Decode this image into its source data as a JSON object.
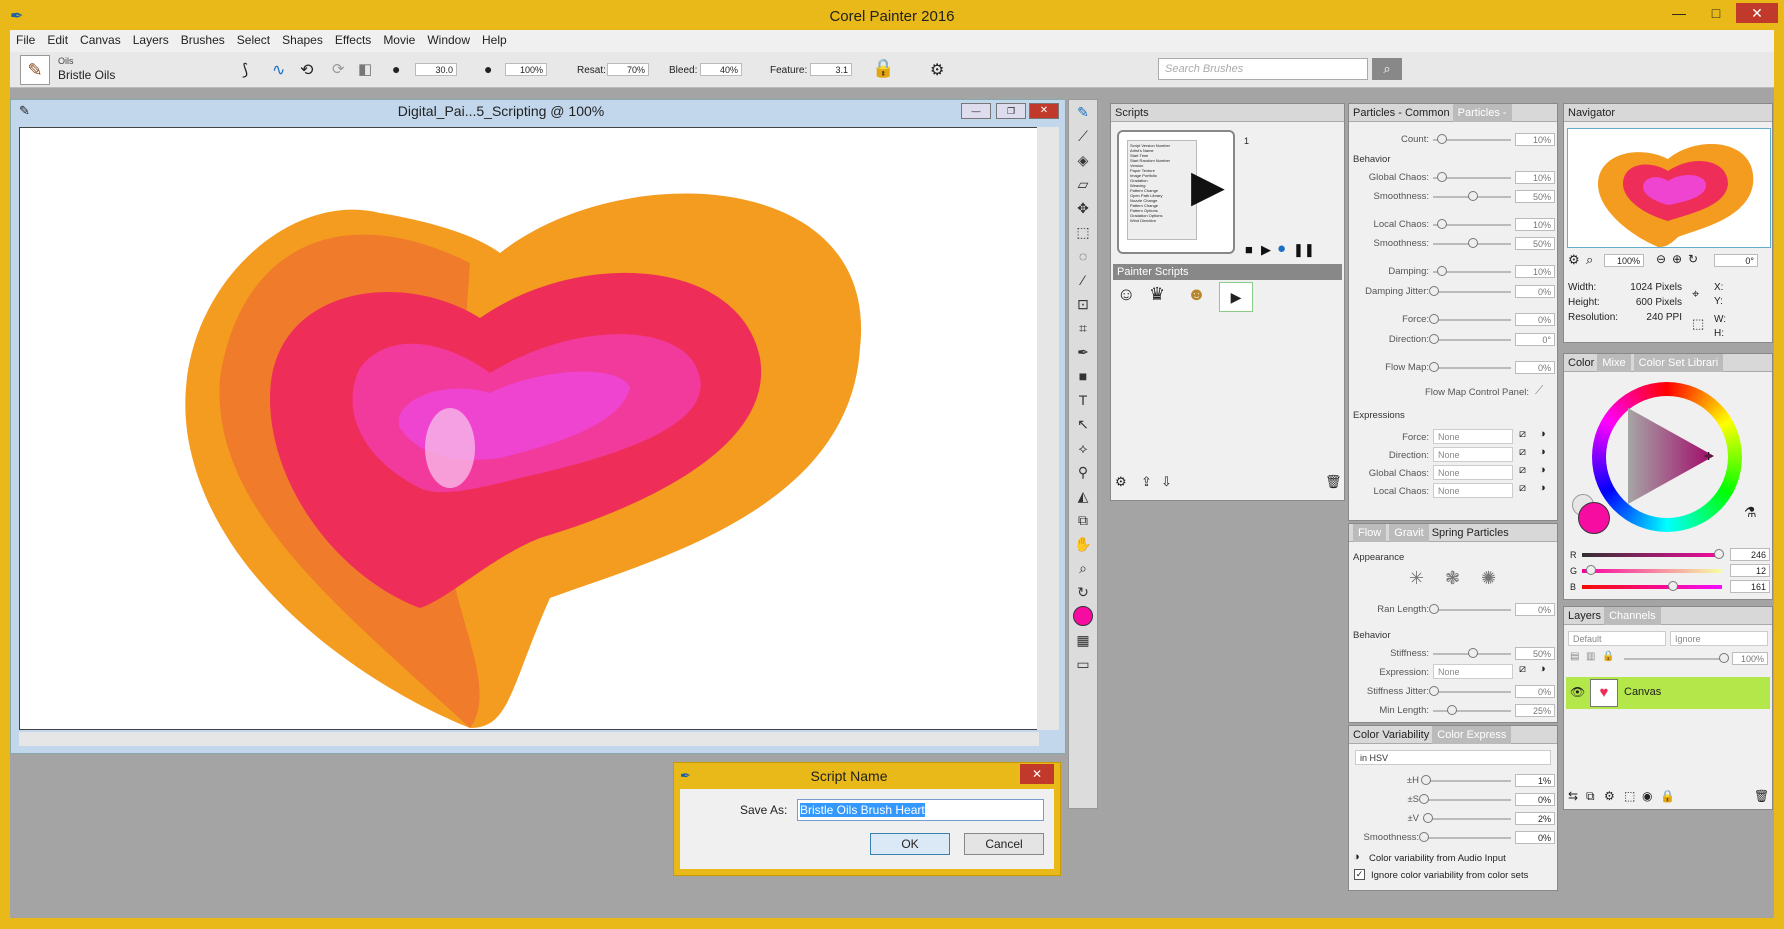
{
  "app": {
    "title": "Corel Painter 2016"
  },
  "menu": [
    "File",
    "Edit",
    "Canvas",
    "Layers",
    "Brushes",
    "Select",
    "Shapes",
    "Effects",
    "Movie",
    "Window",
    "Help"
  ],
  "property_bar": {
    "category": "Oils",
    "variant": "Bristle Oils",
    "size": "30.0",
    "opacity": "100%",
    "resat_label": "Resat:",
    "resat": "70%",
    "bleed_label": "Bleed:",
    "bleed": "40%",
    "feature_label": "Feature:",
    "feature": "3.1",
    "search_placeholder": "Search Brushes"
  },
  "document": {
    "title": "Digital_Pai...5_Scripting @ 100%"
  },
  "scripts": {
    "tab": "Scripts",
    "index": "1",
    "library_label": "Painter Scripts",
    "list_items": [
      "Script Version Number",
      "Artist's Name",
      "Start Time",
      "Start Random Number",
      "Version",
      "Paper Texture",
      "Image Portfolio",
      "Gradation",
      "Weaving",
      "Pattern Change",
      "Open Path Library",
      "Nozzle Change",
      "Pattern Change",
      "Pattern Options",
      "Gradation Options",
      "Wind Direction"
    ]
  },
  "particles": {
    "tab1": "Particles - Common",
    "tab2": "Particles -",
    "count_label": "Count:",
    "count": "10%",
    "behavior_label": "Behavior",
    "global_chaos_label": "Global Chaos:",
    "global_chaos": "10%",
    "smoothness_label": "Smoothness:",
    "smoothness": "50%",
    "local_chaos_label": "Local Chaos:",
    "local_chaos": "10%",
    "smoothness2_label": "Smoothness:",
    "smoothness2": "50%",
    "damping_label": "Damping:",
    "damping": "10%",
    "damping_jitter_label": "Damping Jitter:",
    "damping_jitter": "0%",
    "force_label": "Force:",
    "force": "0%",
    "direction_label": "Direction:",
    "direction": "0°",
    "flow_map_label": "Flow Map:",
    "flow_map": "0%",
    "flow_map_panel_label": "Flow Map Control Panel:",
    "expressions_label": "Expressions",
    "expr_force_label": "Force:",
    "expr_direction_label": "Direction:",
    "expr_global_chaos_label": "Global Chaos:",
    "expr_local_chaos_label": "Local Chaos:",
    "none": "None"
  },
  "spring": {
    "tab_flow": "Flow",
    "tab_gravity": "Gravit",
    "tab_spring": "Spring Particles",
    "appearance_label": "Appearance",
    "ran_length_label": "Ran Length:",
    "ran_length": "0%",
    "behavior_label": "Behavior",
    "stiffness_label": "Stiffness:",
    "stiffness": "50%",
    "expression_label": "Expression:",
    "expression": "None",
    "stiffness_jitter_label": "Stiffness Jitter:",
    "stiffness_jitter": "0%",
    "min_length_label": "Min Length:",
    "min_length": "25%"
  },
  "color_var": {
    "tab": "Color Variability",
    "tab2": "Color Express",
    "mode": "in HSV",
    "h_label": "±H",
    "h": "1%",
    "s_label": "±S",
    "s": "0%",
    "v_label": "±V",
    "v": "2%",
    "smoothness_label": "Smoothness:",
    "smoothness": "0%",
    "audio_label": "Color variability from Audio Input",
    "ignore_label": "Ignore color variability from color sets"
  },
  "navigator": {
    "tab": "Navigator",
    "zoom": "100%",
    "angle": "0°",
    "width_label": "Width:",
    "width": "1024 Pixels",
    "height_label": "Height:",
    "height": "600 Pixels",
    "resolution_label": "Resolution:",
    "resolution": "240 PPI",
    "x_label": "X:",
    "y_label": "Y:",
    "w_label": "W:",
    "h_label": "H:"
  },
  "color": {
    "tab": "Color",
    "tab_mixer": "Mixe",
    "tab_library": "Color Set Librari",
    "r_label": "R",
    "r": "246",
    "g_label": "G",
    "g": "12",
    "b_label": "B",
    "b": "161",
    "main": "#f60ca1"
  },
  "layers": {
    "tab": "Layers",
    "tab2": "Channels",
    "composite": "Default",
    "method": "Ignore",
    "opacity": "100%",
    "layer_name": "Canvas"
  },
  "dialog": {
    "title": "Script Name",
    "save_as_label": "Save As:",
    "value": "Bristle Oils Brush Heart",
    "ok": "OK",
    "cancel": "Cancel"
  }
}
